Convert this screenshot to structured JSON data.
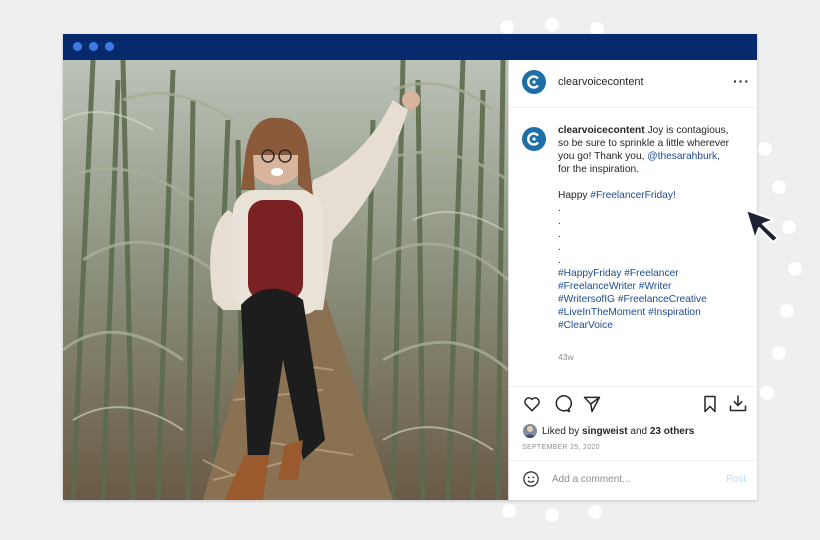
{
  "post": {
    "username": "clearvoicecontent",
    "more_label": "···",
    "caption_lines": [
      "Joy is contagious,",
      "so be sure to sprinkle a little wherever",
      "you go! Thank you, ",
      "for the inspiration.",
      "Happy ",
      "."
    ],
    "mention": "@thesarahburk,",
    "friday_tag": "#FreelancerFriday!",
    "hashtags": [
      [
        "#HappyFriday",
        "#Freelancer"
      ],
      [
        "#FreelanceWriter",
        "#Writer"
      ],
      [
        "#WritersofIG",
        "#FreelanceCreative"
      ],
      [
        "#LiveInTheMoment",
        "#Inspiration"
      ],
      [
        "#ClearVoice"
      ]
    ],
    "time_ago": "43w",
    "liked_prefix": "Liked by ",
    "liked_user": "singweist",
    "liked_mid": " and ",
    "liked_count": "23 others",
    "date": "SEPTEMBER 25, 2020",
    "comment_placeholder": "Add a comment...",
    "post_label": "Post"
  },
  "colors": {
    "title_bar": "#062a6b",
    "title_dots": "#3e7be8",
    "brand": "#1d6fa8",
    "hashtag": "#1d4b8f"
  }
}
